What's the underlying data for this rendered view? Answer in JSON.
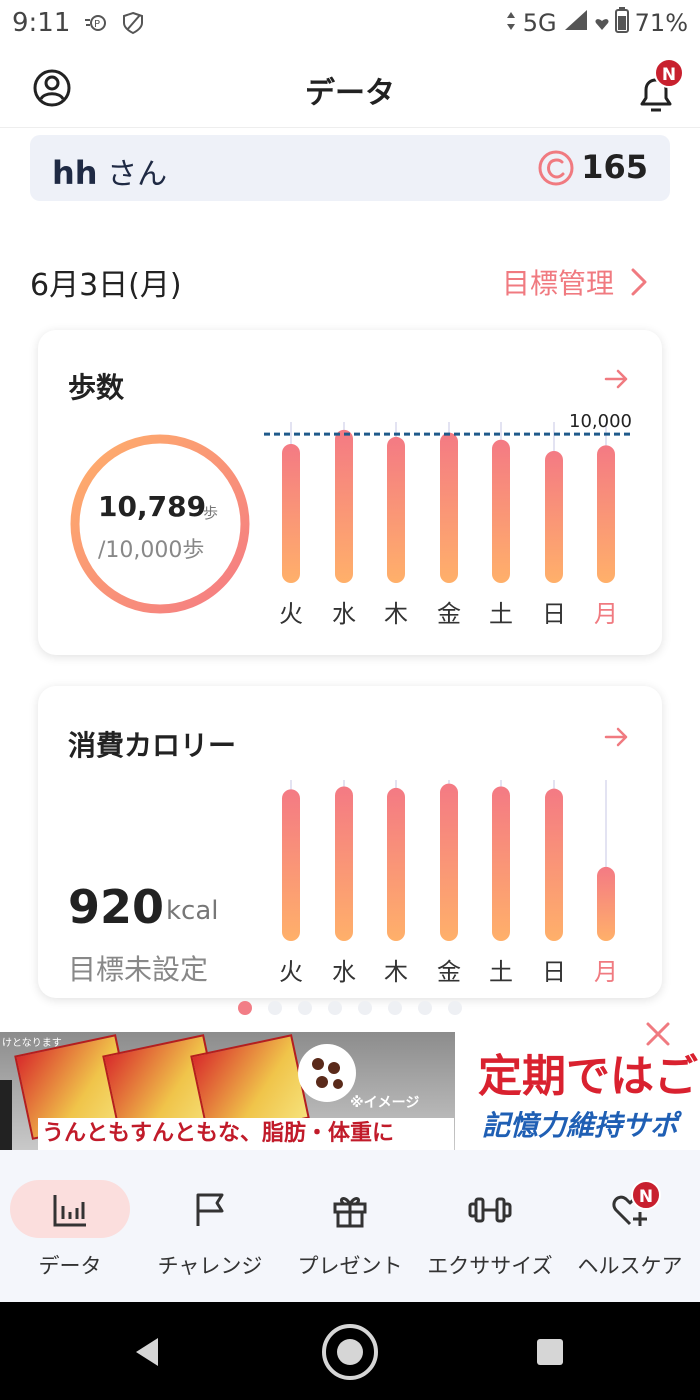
{
  "status_bar": {
    "time": "9:11",
    "network": "5G",
    "battery": "71%"
  },
  "header": {
    "title": "データ",
    "notification_badge": "N"
  },
  "user": {
    "name": "hh",
    "honorific": "さん",
    "coins": "165"
  },
  "date_row": {
    "date": "6月3日(月)",
    "goal_link": "目標管理"
  },
  "steps_card": {
    "title": "歩数",
    "value": "10,789",
    "unit": "歩",
    "goal": "/10,000歩",
    "goal_line_label": "10,000"
  },
  "calorie_card": {
    "title": "消費カロリー",
    "value": "920",
    "unit": "kcal",
    "goal": "目標未設定"
  },
  "chart_data": [
    {
      "type": "bar",
      "title": "歩数",
      "categories": [
        "火",
        "水",
        "木",
        "金",
        "土",
        "日",
        "月"
      ],
      "values": [
        9300,
        10300,
        9800,
        10100,
        9600,
        8800,
        9200
      ],
      "reference_line": {
        "value": 10000,
        "label": "10,000"
      },
      "ylim": [
        0,
        11000
      ],
      "highlight_category": "月",
      "highlight_color": "#f07a80"
    },
    {
      "type": "bar",
      "title": "消費カロリー",
      "categories": [
        "火",
        "水",
        "木",
        "金",
        "土",
        "日",
        "月"
      ],
      "values": [
        2000,
        2040,
        2020,
        2080,
        2040,
        2010,
        920
      ],
      "ylim": [
        0,
        2200
      ],
      "highlight_category": "月",
      "highlight_color": "#f07a80"
    }
  ],
  "pager": {
    "count": 8,
    "active": 0
  },
  "ad": {
    "top_text": "けとなります",
    "note": "※イメージ",
    "caption": "うんともすんともな、脂肪・体重に",
    "headline": "定期ではご",
    "subline": "記憶力維持サポ"
  },
  "bottom_nav": [
    {
      "label": "データ",
      "icon": "bar-chart-icon"
    },
    {
      "label": "チャレンジ",
      "icon": "flag-icon"
    },
    {
      "label": "プレゼント",
      "icon": "gift-icon"
    },
    {
      "label": "エクササイズ",
      "icon": "dumbbell-icon"
    },
    {
      "label": "ヘルスケア",
      "icon": "heart-plus-icon",
      "badge": "N"
    }
  ],
  "colors": {
    "accent": "#f07a80",
    "bar_top": "#f47a84",
    "bar_bottom": "#ffb06a",
    "goal_line": "#1f5a8a"
  }
}
